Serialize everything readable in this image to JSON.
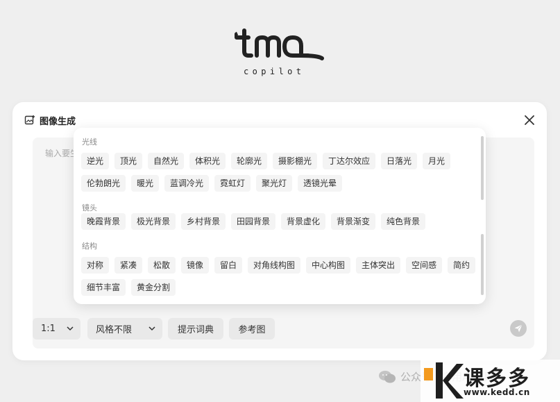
{
  "logo": {
    "sub": "copilot"
  },
  "card": {
    "title": "图像生成",
    "input_placeholder": "输入要生成的图像描述"
  },
  "toolbar": {
    "ratio": "1:1",
    "style": "风格不限",
    "dictionary": "提示词典",
    "reference": "参考图"
  },
  "popover": {
    "sections": [
      {
        "title": "光线",
        "tags": [
          "逆光",
          "顶光",
          "自然光",
          "体积光",
          "轮廓光",
          "摄影棚光",
          "丁达尔效应",
          "日落光",
          "月光",
          "伦勃朗光",
          "暖光",
          "蓝调冷光",
          "霓虹灯",
          "聚光灯",
          "透镜光晕"
        ]
      },
      {
        "title": "镜头",
        "tags": [
          "晚霞背景",
          "极光背景",
          "乡村背景",
          "田园背景",
          "背景虚化",
          "背景渐变",
          "纯色背景"
        ]
      },
      {
        "title": "结构",
        "tags": [
          "对称",
          "紧凑",
          "松散",
          "镜像",
          "留白",
          "对角线构图",
          "中心构图",
          "主体突出",
          "空间感",
          "简约",
          "细节丰富",
          "黄金分割"
        ]
      }
    ]
  },
  "watermark": {
    "text": "公众号 · 实用AI工具"
  },
  "brand": {
    "name": "课多多",
    "url": "www.kedd.cn"
  },
  "colors": {
    "brand_orange": "#f39a1e",
    "brand_dark": "#1e1e1e"
  }
}
